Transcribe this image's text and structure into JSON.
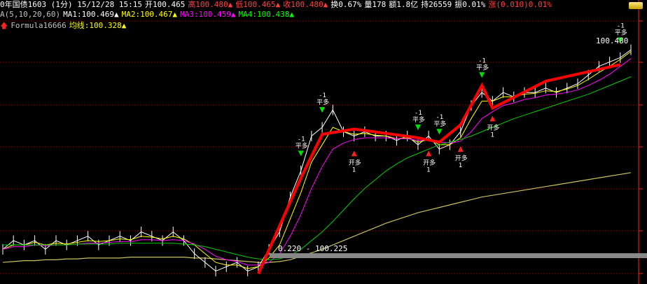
{
  "header": {
    "title": "0年国债1603 (1分) 15/12/28 15:15",
    "open_label": "开100.465",
    "high_label": "高100.480▲",
    "low_label": "低100.465▲",
    "close_label": "收100.480▲",
    "turnover_label": "换0.67%",
    "volume_label": "量178",
    "amount_label": "额1.8亿",
    "position_label": "持26559",
    "amplitude_label": "振0.01%",
    "change_label": "涨(0.010)0.01%"
  },
  "ma_row": {
    "name": "A(5,10,20,60)",
    "ma1": "MA1:100.469▲",
    "ma2": "MA2:100.467▲",
    "ma3": "MA3:100.459▲",
    "ma4": "MA4:100.438▲"
  },
  "formula_row": {
    "name": "Formula16666",
    "avg_line": "均线:100.328▲"
  },
  "annotations": {
    "high_price": "100.480",
    "range_label": "0.220 - 100.225",
    "signal_open_long": "开多",
    "signal_open_short": "平多",
    "signal_count": "-1",
    "signal_one": "1"
  },
  "colors": {
    "background": "#000000",
    "grid": "#8a0000",
    "candle": "#ffffff",
    "ma5": "#ffffff",
    "ma10": "#ffff00",
    "ma20": "#ff00ff",
    "ma60": "#00cc00",
    "avg": "#c8c060",
    "zigzag": "#ff0000",
    "buy_arrow": "#ff2020",
    "sell_arrow": "#00e000"
  },
  "chart_data": {
    "type": "line",
    "title": "0年国债1603 (1分)",
    "ylim": [
      100.205,
      100.49
    ],
    "grid": true,
    "series": [
      {
        "name": "MA1",
        "values": [
          100.24,
          100.25,
          100.245,
          100.25,
          100.24,
          100.25,
          100.245,
          100.25,
          100.255,
          100.245,
          100.25,
          100.255,
          100.25,
          100.26,
          100.255,
          100.25,
          100.26,
          100.25,
          100.235,
          100.225,
          100.215,
          100.22,
          100.225,
          100.215,
          100.22,
          100.24,
          100.26,
          100.3,
          100.33,
          100.37,
          100.38,
          100.4,
          100.375,
          100.37,
          100.375,
          100.37,
          100.37,
          100.365,
          100.37,
          100.36,
          100.37,
          100.355,
          100.36,
          100.375,
          100.405,
          100.42,
          100.41,
          100.42,
          100.415,
          100.42,
          100.42,
          100.425,
          100.42,
          100.425,
          100.43,
          100.44,
          100.45,
          100.455,
          100.46,
          100.469
        ]
      },
      {
        "name": "MA2",
        "values": [
          100.24,
          100.245,
          100.245,
          100.248,
          100.245,
          100.247,
          100.246,
          100.248,
          100.25,
          100.249,
          100.25,
          100.252,
          100.251,
          100.255,
          100.254,
          100.252,
          100.255,
          100.252,
          100.245,
          100.235,
          100.225,
          100.222,
          100.222,
          100.218,
          100.22,
          100.23,
          100.245,
          100.275,
          100.305,
          100.34,
          100.36,
          100.38,
          100.375,
          100.372,
          100.373,
          100.371,
          100.37,
          100.367,
          100.368,
          100.363,
          100.366,
          100.36,
          100.36,
          100.368,
          100.39,
          100.41,
          100.41,
          100.415,
          100.415,
          100.418,
          100.419,
          100.422,
          100.421,
          100.424,
          100.428,
          100.435,
          100.443,
          100.45,
          100.458,
          100.467
        ]
      },
      {
        "name": "MA3",
        "values": [
          100.24,
          100.243,
          100.243,
          100.245,
          100.244,
          100.245,
          100.245,
          100.246,
          100.247,
          100.247,
          100.248,
          100.249,
          100.249,
          100.251,
          100.251,
          100.25,
          100.251,
          100.25,
          100.246,
          100.24,
          100.232,
          100.228,
          100.226,
          100.222,
          100.222,
          100.225,
          100.235,
          100.255,
          100.28,
          100.31,
          100.335,
          100.355,
          100.362,
          100.366,
          100.368,
          100.368,
          100.368,
          100.367,
          100.367,
          100.365,
          100.366,
          100.363,
          100.362,
          100.364,
          100.375,
          100.39,
          100.398,
          100.405,
          100.408,
          100.412,
          100.414,
          100.417,
          100.418,
          100.42,
          100.423,
          100.428,
          100.434,
          100.441,
          100.45,
          100.459
        ]
      },
      {
        "name": "MA4",
        "values": [
          100.245,
          100.245,
          100.245,
          100.245,
          100.245,
          100.245,
          100.245,
          100.246,
          100.246,
          100.246,
          100.246,
          100.247,
          100.247,
          100.247,
          100.247,
          100.247,
          100.247,
          100.246,
          100.245,
          100.243,
          100.24,
          100.237,
          100.234,
          100.231,
          100.229,
          100.228,
          100.229,
          100.233,
          100.24,
          100.25,
          100.26,
          100.272,
          100.285,
          100.298,
          100.31,
          100.32,
          100.33,
          100.338,
          100.345,
          100.35,
          100.355,
          100.36,
          100.363,
          100.366,
          100.37,
          100.375,
          100.38,
          100.385,
          100.39,
          100.394,
          100.398,
          100.402,
          100.406,
          100.41,
          100.414,
          100.418,
          100.423,
          100.428,
          100.433,
          100.438
        ]
      },
      {
        "name": "均线",
        "values": [
          100.225,
          100.226,
          100.227,
          100.227,
          100.228,
          100.228,
          100.229,
          100.229,
          100.23,
          100.23,
          100.23,
          100.23,
          100.231,
          100.231,
          100.231,
          100.231,
          100.231,
          100.231,
          100.23,
          100.23,
          100.229,
          100.228,
          100.227,
          100.226,
          100.225,
          100.225,
          100.226,
          100.228,
          100.232,
          100.236,
          100.24,
          100.245,
          100.25,
          100.255,
          100.26,
          100.265,
          100.27,
          100.274,
          100.278,
          100.282,
          100.285,
          100.288,
          100.291,
          100.294,
          100.297,
          100.3,
          100.302,
          100.304,
          100.306,
          100.308,
          100.31,
          100.312,
          100.314,
          100.316,
          100.318,
          100.32,
          100.322,
          100.324,
          100.326,
          100.328
        ]
      }
    ]
  }
}
